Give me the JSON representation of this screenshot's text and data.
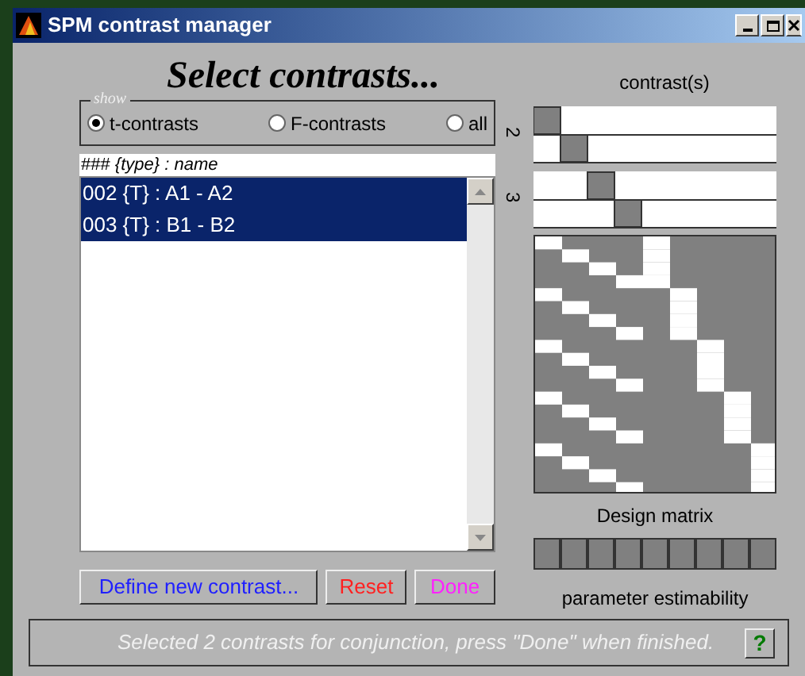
{
  "window": {
    "title": "SPM contrast manager"
  },
  "heading": "Select contrasts...",
  "show_group": {
    "label": "show",
    "options": [
      {
        "label": "t-contrasts",
        "selected": true
      },
      {
        "label": "F-contrasts",
        "selected": false
      },
      {
        "label": "all",
        "selected": false
      }
    ]
  },
  "list": {
    "header": "### *{type} : name*",
    "items": [
      {
        "label": "002 {T} : A1 - A2",
        "selected": true
      },
      {
        "label": "003 {T} : B1 - B2",
        "selected": true
      }
    ]
  },
  "buttons": [
    {
      "label": "Define new contrast...",
      "color": "#2020ff"
    },
    {
      "label": "Reset",
      "color": "#ff2020"
    },
    {
      "label": "Done",
      "color": "#ff20ff"
    }
  ],
  "contrast_panel": {
    "title": "contrast(s)",
    "contrasts": [
      {
        "label": "2"
      },
      {
        "label": "3"
      }
    ]
  },
  "design_matrix": {
    "title": "Design matrix"
  },
  "estimability": {
    "title": "parameter estimability"
  },
  "status_bar": {
    "text": "Selected 2 contrasts for conjunction, press \"Done\" when finished.",
    "help": "?"
  }
}
